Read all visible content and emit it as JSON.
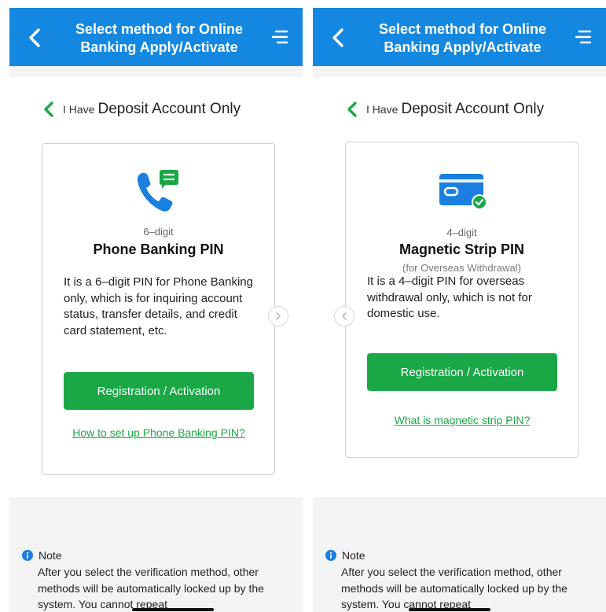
{
  "header": {
    "title_line1": "Select method for Online",
    "title_line2": "Banking Apply/Activate"
  },
  "section": {
    "prefix": "I Have",
    "title": "Deposit Account Only"
  },
  "cards": [
    {
      "icon": "phone-chat-icon",
      "digits": "6–digit",
      "name": "Phone Banking PIN",
      "subtitle": "",
      "description": "It is a 6–digit PIN for Phone Banking only, which is for inquiring account status, transfer details, and credit card statement, etc.",
      "button": "Registration / Activation",
      "link": "How to set up Phone Banking PIN?"
    },
    {
      "icon": "card-check-icon",
      "digits": "4–digit",
      "name": "Magnetic Strip PIN",
      "subtitle": "(for Overseas Withdrawal)",
      "description": "It is a 4–digit PIN for overseas withdrawal only, which is not for domestic use.",
      "button": "Registration / Activation",
      "link": "What is magnetic strip PIN?"
    }
  ],
  "note": {
    "title": "Note",
    "text": "After you select the verification method, other methods will be automatically locked up by the system. You cannot repeat"
  },
  "colors": {
    "header_blue": "#1488e0",
    "accent_green": "#1aa846",
    "card_blue": "#1a7fe0"
  }
}
